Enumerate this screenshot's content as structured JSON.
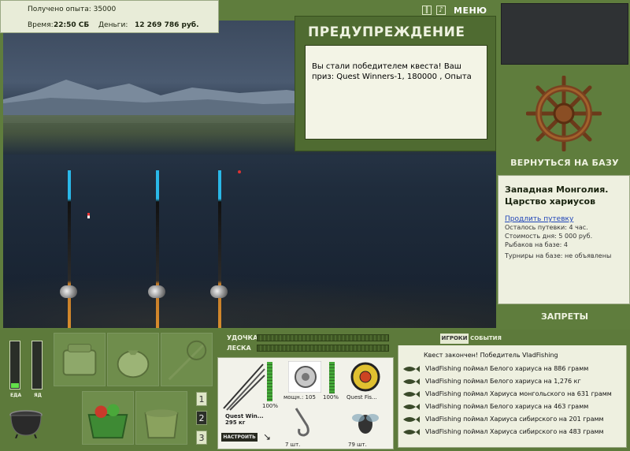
{
  "info": {
    "exp_text": "Получено опыта: 35000",
    "time_label": "Время:",
    "time_value": "22:50 СБ",
    "money_label": "Деньги:",
    "money_value": "12 269 786 руб."
  },
  "topbar": {
    "menu_label": "МЕНЮ"
  },
  "warning": {
    "title": "ПРЕДУПРЕЖДЕНИЕ",
    "message": "Вы стали победителем квеста! Ваш приз: Quest Winners-1, 180000 , Опыта"
  },
  "sidebar": {
    "return_label": "ВЕРНУТЬСЯ НА БАЗУ",
    "location": "Западная Монголия. Царство хариусов",
    "extend_link": "Продлить путевку",
    "lines": [
      "Осталось путевки: 4 час.",
      "Стоимость дня: 5 000 руб.",
      "Рыбаков на базе: 4",
      "Турниры на базе: не объявлены"
    ],
    "bans_label": "ЗАПРЕТЫ"
  },
  "gauges": {
    "food_label": "ЕДА",
    "poison_label": "ЯД",
    "food_level": 0.1,
    "poison_level": 0
  },
  "pages": [
    "1",
    "2",
    "3"
  ],
  "tackle": {
    "rod_label": "УДОЧКА",
    "line_label": "ЛЕСКА",
    "rod_name": "Quest Win...",
    "rod_weight": "295 кг",
    "rod_condition": "100%",
    "reel_info": "мощн.: 105",
    "reel_condition": "100%",
    "line_name": "Quest Fis...",
    "hook_count": "7 шт.",
    "bait_count": "79 шт.",
    "setup_button": "НАСТРОИТЬ"
  },
  "events": {
    "tab_players": "ИГРОКИ",
    "tab_events": "СОБЫТИЯ",
    "header": "Квест закончен! Победитель VladFishing",
    "items": [
      "VladFishing поймал Белого хариуса на 886 грамм",
      "VladFishing поймал Белого хариуса на 1,276 кг",
      "VladFishing поймал Хариуса монгольского на 631 грамм",
      "VladFishing поймал Белого хариуса на 463 грамм",
      "VladFishing поймал Хариуса сибирского на 201 грамм",
      "VladFishing поймал Хариуса сибирского на 483 грамм"
    ]
  },
  "colors": {
    "panel_green": "#5f7d3d",
    "dialog_green": "#4f6b31",
    "link_blue": "#1f44b8"
  }
}
